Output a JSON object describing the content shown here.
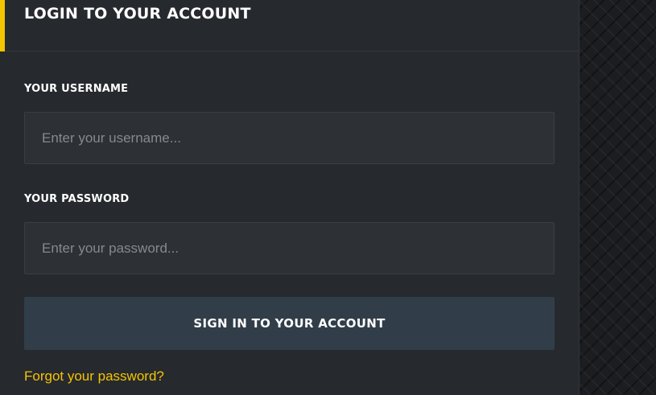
{
  "login": {
    "title": "LOGIN TO YOUR ACCOUNT",
    "username_label": "YOUR USERNAME",
    "username_placeholder": "Enter your username...",
    "password_label": "YOUR PASSWORD",
    "password_placeholder": "Enter your password...",
    "submit_label": "SIGN IN TO YOUR ACCOUNT",
    "forgot_link": "Forgot your password?"
  },
  "colors": {
    "accent": "#f5c400",
    "panel_bg": "#26292d",
    "input_bg": "#2d3034",
    "button_bg": "#313d48"
  }
}
